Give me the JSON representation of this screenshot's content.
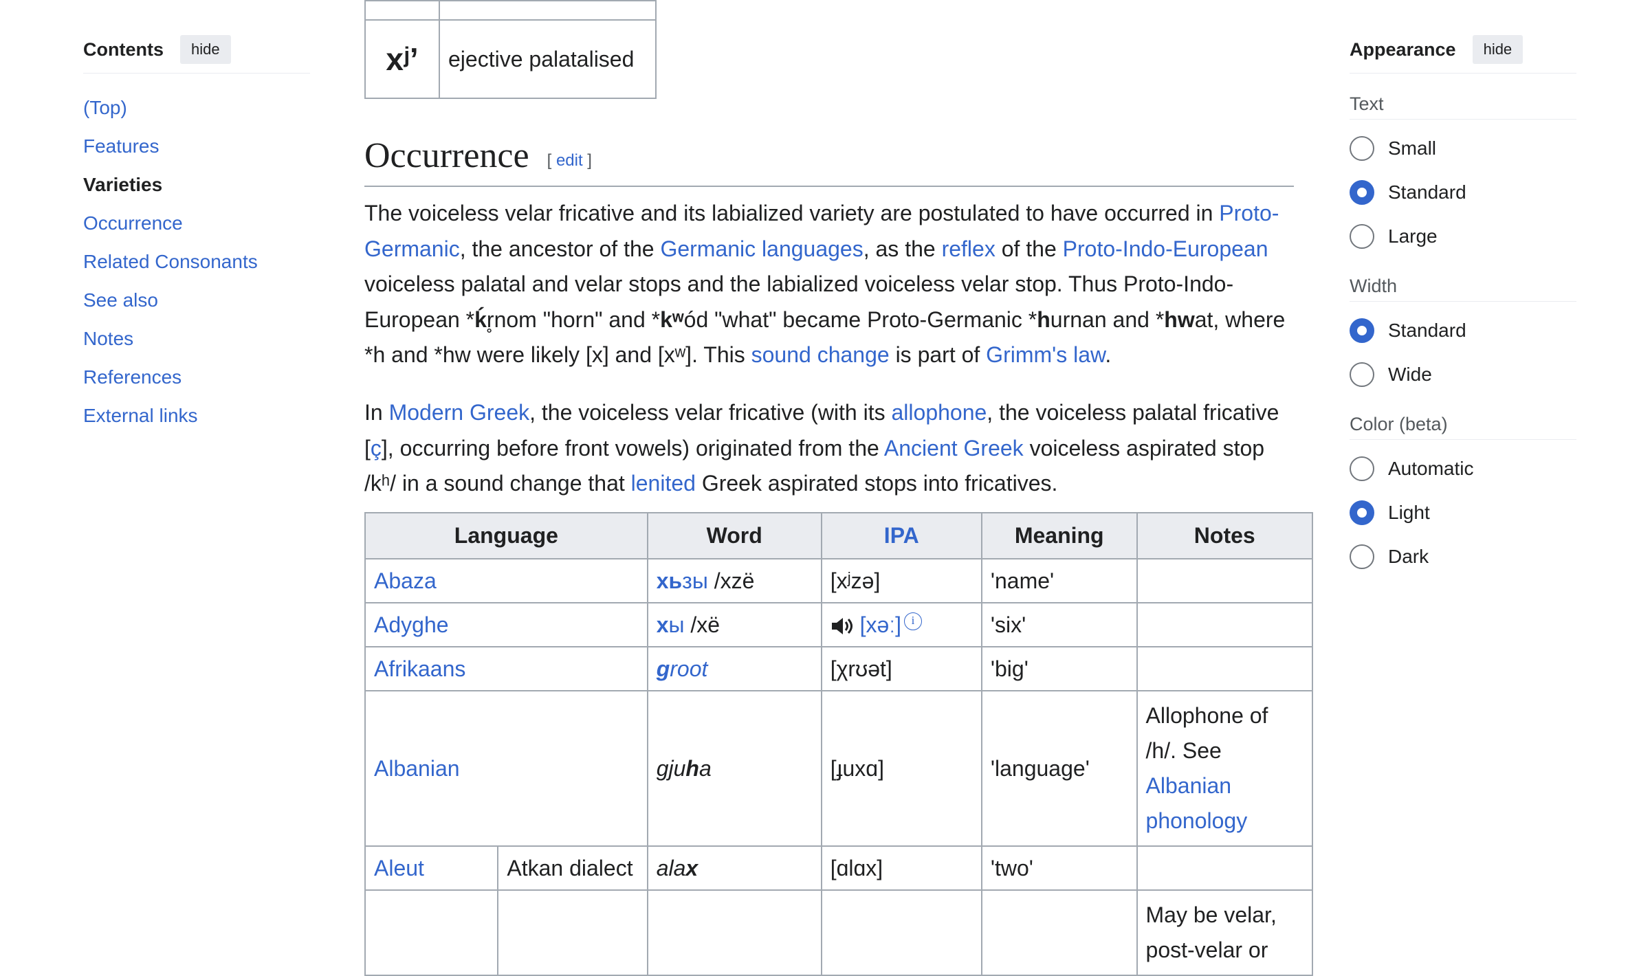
{
  "toc": {
    "title": "Contents",
    "hide_label": "hide",
    "items": [
      {
        "label": "(Top)"
      },
      {
        "label": "Features"
      },
      {
        "label": "Varieties"
      },
      {
        "label": "Occurrence"
      },
      {
        "label": "Related Consonants"
      },
      {
        "label": "See also"
      },
      {
        "label": "Notes"
      },
      {
        "label": "References"
      },
      {
        "label": "External links"
      }
    ]
  },
  "top_table": {
    "symbol": "xʲʼ",
    "description": "ejective palatalised"
  },
  "section": {
    "heading": "Occurrence",
    "edit_open": "[ ",
    "edit_label": "edit",
    "edit_close": " ]"
  },
  "para1": {
    "t1": "The voiceless velar fricative and its labialized variety are postulated to have occurred in ",
    "l1": "Proto-Germanic",
    "t2": ", the ancestor of the ",
    "l2": "Germanic languages",
    "t3": ", as the ",
    "l3": "reflex",
    "t4": " of the ",
    "l4": "Proto-Indo-European",
    "t5": " voiceless palatal and velar stops and the labialized voiceless velar stop. Thus Proto-Indo-European *",
    "b1": "ḱ",
    "t6": "r̥nom \"horn\" and *",
    "b2": "kʷ",
    "t7": "ód \"what\" became Proto-Germanic *",
    "b3": "h",
    "t8": "urnan and *",
    "b4": "hw",
    "t9": "at, where *h and *hw were likely [x] and [xʷ]. This ",
    "l5": "sound change",
    "t10": " is part of ",
    "l6": "Grimm's law",
    "t11": "."
  },
  "para2": {
    "t1": "In ",
    "l1": "Modern Greek",
    "t2": ", the voiceless velar fricative (with its ",
    "l2": "allophone",
    "t3": ", the voiceless palatal fricative [",
    "l3": "ç",
    "t4": "], occurring before front vowels) originated from the ",
    "l4": "Ancient Greek",
    "t5": " voiceless aspirated stop /kʰ/ in a sound change that ",
    "l5": "lenited",
    "t6": " Greek aspirated stops into fricatives."
  },
  "table": {
    "headers": {
      "language": "Language",
      "word": "Word",
      "ipa": "IPA",
      "meaning": "Meaning",
      "notes": "Notes"
    },
    "rows": [
      {
        "language": "Abaza",
        "word_link": "хь",
        "word_rest_link": "зы",
        "word_tail": " /xzë",
        "ipa": "[xʲzə]",
        "meaning": "'name'",
        "notes": ""
      },
      {
        "language": "Adyghe",
        "word_link": "х",
        "word_rest_link": "ы",
        "word_tail": " /xë",
        "ipa": "[xəː]",
        "meaning": "'six'",
        "notes": ""
      },
      {
        "language": "Afrikaans",
        "word_bold": "g",
        "word_rest": "root",
        "ipa": "[χrʊət]",
        "meaning": "'big'",
        "notes": ""
      },
      {
        "language": "Albanian",
        "word_pre": "gju",
        "word_bold": "h",
        "word_post": "a",
        "ipa": "[ɟuxɑ]",
        "meaning": "'language'",
        "notes_text": "Allophone of /h/. See ",
        "notes_link": "Albanian phonology"
      },
      {
        "language": "Aleut",
        "dialect": "Atkan dialect",
        "word_pre": "ala",
        "word_bold": "x",
        "ipa": "[ɑlɑx]",
        "meaning": "'two'",
        "notes": ""
      },
      {
        "notes": "May be velar, post-velar or"
      }
    ]
  },
  "appearance": {
    "title": "Appearance",
    "hide_label": "hide",
    "text_label": "Text",
    "text_options": [
      "Small",
      "Standard",
      "Large"
    ],
    "text_selected": "Standard",
    "width_label": "Width",
    "width_options": [
      "Standard",
      "Wide"
    ],
    "width_selected": "Standard",
    "color_label": "Color (beta)",
    "color_options": [
      "Automatic",
      "Light",
      "Dark"
    ],
    "color_selected": "Light"
  },
  "colors": {
    "link": "#3366cc",
    "radio_on": "#3366cc",
    "border": "#a2a9b1"
  }
}
